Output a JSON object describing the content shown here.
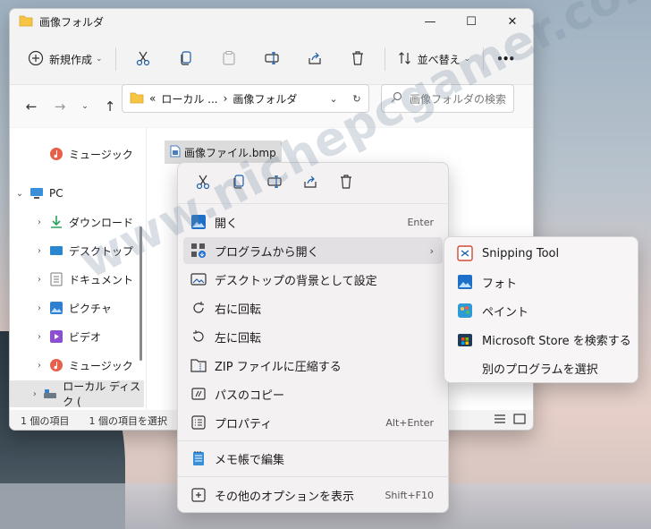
{
  "window": {
    "title": "画像フォルダ"
  },
  "toolbar": {
    "new_label": "新規作成",
    "sort_label": "並べ替え",
    "more_label": "•••"
  },
  "nav": {
    "address_root": "ローカル ...",
    "address_sep": "«",
    "address_folder": "画像フォルダ",
    "search_placeholder": "画像フォルダの検索"
  },
  "tree": {
    "items": [
      {
        "label": "ミュージック"
      },
      {
        "label": "PC"
      },
      {
        "label": "ダウンロード"
      },
      {
        "label": "デスクトップ"
      },
      {
        "label": "ドキュメント"
      },
      {
        "label": "ピクチャ"
      },
      {
        "label": "ビデオ"
      },
      {
        "label": "ミュージック"
      },
      {
        "label": "ローカル ディスク ("
      }
    ]
  },
  "file": {
    "name": "画像ファイル.bmp"
  },
  "status": {
    "count": "1 個の項目",
    "selected": "1 個の項目を選択"
  },
  "menu": {
    "items": [
      {
        "label": "開く",
        "shortcut": "Enter"
      },
      {
        "label": "プログラムから開く",
        "submenu": "›"
      },
      {
        "label": "デスクトップの背景として設定"
      },
      {
        "label": "右に回転"
      },
      {
        "label": "左に回転"
      },
      {
        "label": "ZIP ファイルに圧縮する"
      },
      {
        "label": "パスのコピー"
      },
      {
        "label": "プロパティ",
        "shortcut": "Alt+Enter"
      },
      {
        "label": "メモ帳で編集"
      },
      {
        "label": "その他のオプションを表示",
        "shortcut": "Shift+F10"
      }
    ]
  },
  "submenu": {
    "items": [
      {
        "label": "Snipping Tool"
      },
      {
        "label": "フォト"
      },
      {
        "label": "ペイント"
      },
      {
        "label": "Microsoft Store を検索する"
      },
      {
        "label": "別のプログラムを選択"
      }
    ]
  },
  "watermark": "www.nichepcgamer.com",
  "colors": {
    "accent": "#0067c0",
    "folder": "#f7c544",
    "menu_bg": "#f4f1f3"
  }
}
